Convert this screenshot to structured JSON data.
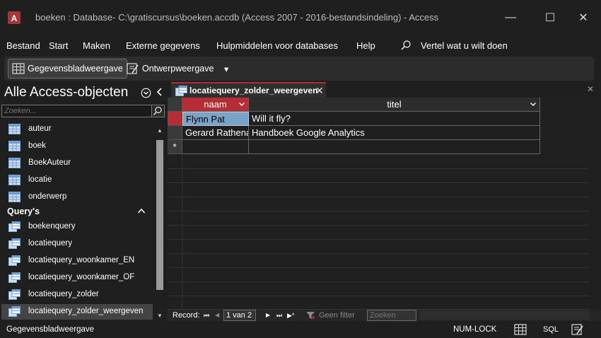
{
  "window": {
    "title": "boeken : Database- C:\\gratiscursus\\boeken.accdb (Access 2007 - 2016-bestandsindeling)  -  Access",
    "app_icon_letter": "A",
    "controls": {
      "minimize": "—",
      "maximize": "☐",
      "close": "✕"
    }
  },
  "menu": {
    "items": [
      "Bestand",
      "Start",
      "Maken",
      "Externe gegevens",
      "Hulpmiddelen voor databases",
      "Help"
    ],
    "tell_me": "Vertel wat u wilt doen"
  },
  "ribbon": {
    "datasheet_view": "Gegevensbladweergave",
    "design_view": "Ontwerpweergave",
    "more": "▾"
  },
  "nav_pane": {
    "title": "Alle Access-objecten",
    "search_placeholder": "Zoeken...",
    "tables": [
      "auteur",
      "boek",
      "BoekAuteur",
      "locatie",
      "onderwerp"
    ],
    "queries_group": "Query's",
    "queries": [
      "boekenquery",
      "locatiequery",
      "locatiequery_woonkamer_EN",
      "locatiequery_woonkamer_OF",
      "locatiequery_zolder",
      "locatiequery_zolder_weergeven"
    ],
    "selected": "locatiequery_zolder_weergeven"
  },
  "document": {
    "tab_label": "locatiequery_zolder_weergeven",
    "tab_close": "✕",
    "close_all": "✕",
    "columns": [
      "naam",
      "titel"
    ],
    "rows": [
      {
        "naam": "Flynn Pat",
        "titel": "Will it fly?"
      },
      {
        "naam": "Gerard Rathenau",
        "titel": "Handboek Google Analytics"
      }
    ],
    "new_row_marker": "*"
  },
  "record_bar": {
    "label": "Record:",
    "first": "⏮",
    "prev": "◀",
    "current": "1 van 2",
    "next": "▶",
    "last": "⏭",
    "new": "▶*",
    "filter": "Geen filter",
    "search": "Zoeken"
  },
  "status": {
    "view": "Gegevensbladweergave",
    "numlock": "NUM-LOCK",
    "sql": "SQL"
  },
  "colors": {
    "accent": "#b52e36",
    "focus_cell": "#7aa3c9",
    "background": "#1f1f1f"
  }
}
